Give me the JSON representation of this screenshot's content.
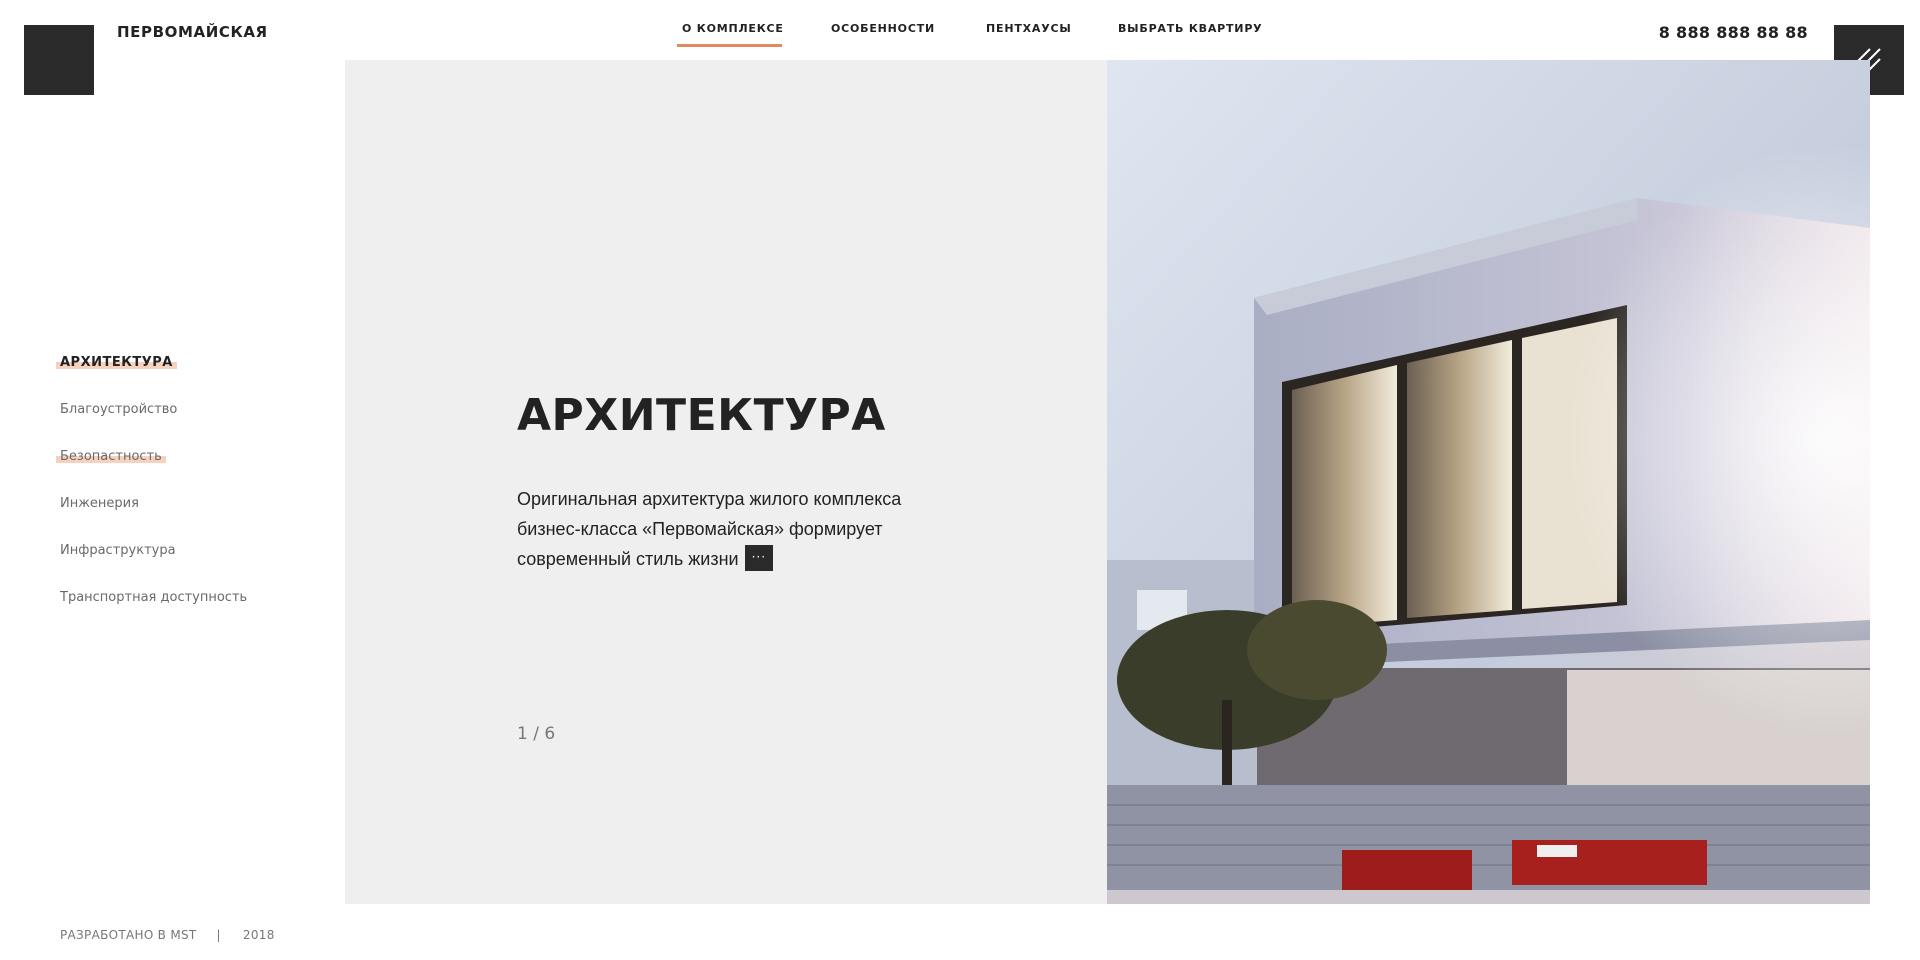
{
  "brand": {
    "name": "ПЕРВОМАЙСКАЯ"
  },
  "nav": {
    "items": [
      {
        "label": "О КОМПЛЕКСЕ",
        "active": true
      },
      {
        "label": "ОСОБЕННОСТИ"
      },
      {
        "label": "ПЕНТХАУСЫ"
      },
      {
        "label": "ВЫБРАТЬ КВАРТИРУ"
      }
    ],
    "accent_color": "#e08a5f"
  },
  "header": {
    "phone": "8 888 888 88 88",
    "menu_icon": "hamburger-slash-icon"
  },
  "sidebar": {
    "items": [
      {
        "label": "АРХИТЕКТУРА",
        "active": true
      },
      {
        "label": "Благоустройство"
      },
      {
        "label": "Безопастность",
        "highlighted": true
      },
      {
        "label": "Инженерия"
      },
      {
        "label": "Инфраструктура"
      },
      {
        "label": "Транспортная доступность"
      }
    ],
    "highlight_color": "#f4c6ad"
  },
  "main": {
    "title": "АРХИТЕКТУРА",
    "description": "Оригинальная архитектура жилого комплекса бизнес-класса «Первомайская» формирует современный стиль жизни",
    "more_label": "···",
    "pager": "1 / 6"
  },
  "footer": {
    "credit": "РАЗРАБОТАНО В MST",
    "separator": "|",
    "year": "2018"
  }
}
